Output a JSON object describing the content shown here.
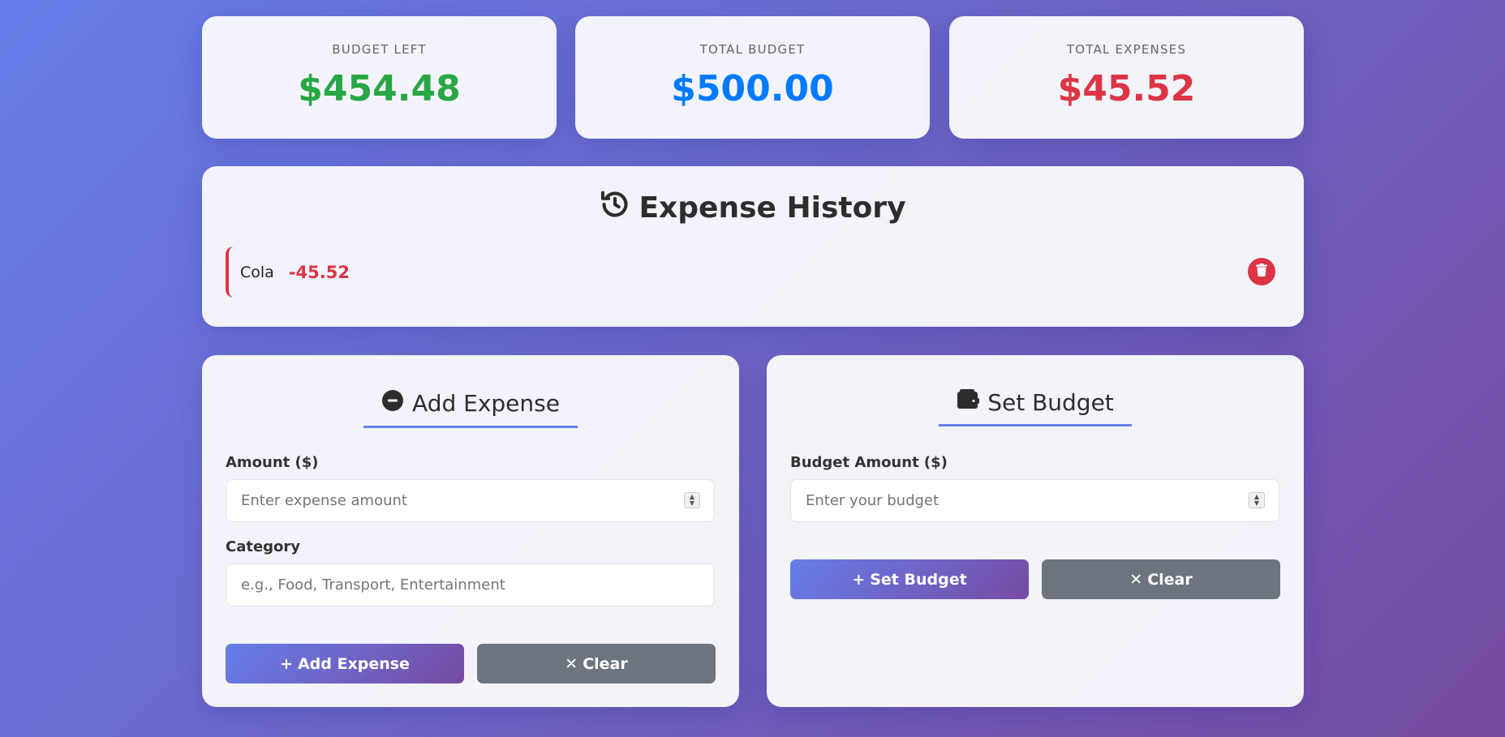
{
  "summary": {
    "budget_left": {
      "label": "BUDGET LEFT",
      "value": "$454.48",
      "color": "#28a745"
    },
    "total_budget": {
      "label": "TOTAL BUDGET",
      "value": "$500.00",
      "color": "#007bff"
    },
    "total_expenses": {
      "label": "TOTAL EXPENSES",
      "value": "$45.52",
      "color": "#dc3545"
    }
  },
  "history": {
    "title": "Expense History",
    "icon": "history-icon",
    "items": [
      {
        "category": "Cola",
        "amount": "-45.52",
        "delete_icon": "trash-icon"
      }
    ]
  },
  "add_expense": {
    "title": "Add Expense",
    "icon": "minus-circle-icon",
    "amount_label": "Amount ($)",
    "amount_placeholder": "Enter expense amount",
    "category_label": "Category",
    "category_placeholder": "e.g., Food, Transport, Entertainment",
    "submit_label": "Add Expense",
    "clear_label": "Clear"
  },
  "set_budget": {
    "title": "Set Budget",
    "icon": "wallet-icon",
    "amount_label": "Budget Amount ($)",
    "amount_placeholder": "Enter your budget",
    "submit_label": "Set Budget",
    "clear_label": "Clear"
  },
  "colors": {
    "accent": "#667eea",
    "accent_end": "#764ba2",
    "danger": "#dc3545",
    "success": "#28a745",
    "info": "#007bff",
    "secondary": "#6c757d"
  }
}
